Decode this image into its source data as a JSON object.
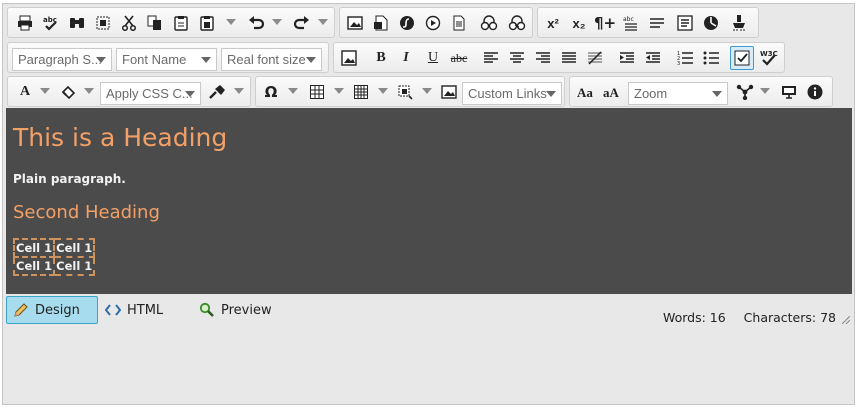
{
  "toolbar_row1": {
    "groups": [
      {
        "name": "editing",
        "tools": [
          "print-icon",
          "spellcheck-icon",
          "find-replace-icon",
          "select-all-icon",
          "cut-icon",
          "copy-icon",
          "paste-icon",
          "paste-options-icon",
          "undo-icon",
          "redo-icon"
        ]
      },
      {
        "name": "insert",
        "tools": [
          "image-manager-icon",
          "document-manager-icon",
          "flash-manager-icon",
          "media-manager-icon",
          "template-manager-icon",
          "link-manager-icon",
          "unlink-icon"
        ]
      },
      {
        "name": "format-marks",
        "tools": [
          "superscript-icon",
          "subscript-icon",
          "paragraph-mark-icon",
          "abc-spell-icon",
          "horizontal-rule-icon",
          "form-element-icon",
          "module-icon",
          "format-stripper-icon"
        ]
      }
    ]
  },
  "toolbar_row2": {
    "paragraph_style": "Paragraph S...",
    "font_name": "Font Name",
    "font_size": "Real font size",
    "bold_label": "B",
    "italic_label": "I",
    "underline_label": "U",
    "strike_label": "abc"
  },
  "toolbar_row3": {
    "css_class": "Apply CSS C...",
    "custom_links": "Custom Links",
    "zoom": "Zoom",
    "case_upper": "Aa",
    "case_lower": "aA",
    "symbol_label": "Ω",
    "forecolor_label": "A"
  },
  "content": {
    "heading1": "This is a Heading",
    "paragraph": "Plain paragraph.",
    "heading2": "Second Heading",
    "table": [
      [
        "Cell 1",
        "Cell 1"
      ],
      [
        "Cell 1",
        "Cell 1"
      ]
    ],
    "colors": {
      "background": "#4c4b4b",
      "heading": "#f3a066",
      "text": "#f2f2f2",
      "table_border": "#d0935e"
    }
  },
  "modes": {
    "design": "Design",
    "html": "HTML",
    "preview": "Preview",
    "active": "design"
  },
  "status": {
    "words_label": "Words: 16",
    "chars_label": "Characters: 78"
  },
  "colors": {
    "accent": "#3aa5c9",
    "toolbar": "#e8e8e8"
  }
}
